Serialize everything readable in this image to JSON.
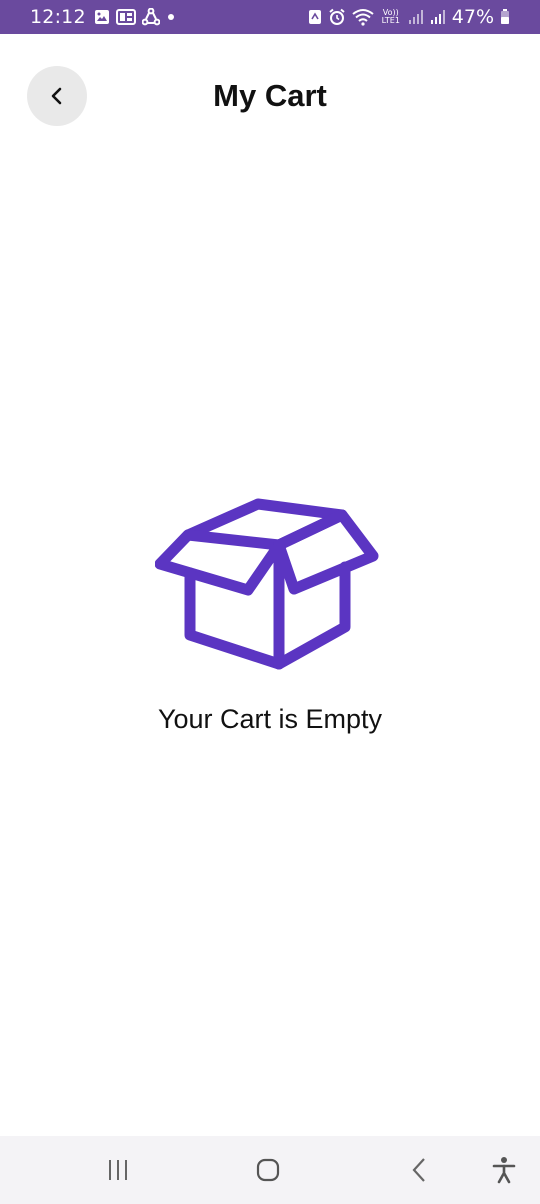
{
  "status_bar": {
    "time": "12:12",
    "battery_percent": "47%",
    "network_label": "Vo)) LTE1",
    "background_color": "#6a4a9e",
    "left_icons": [
      "gallery-icon",
      "sim-card-icon",
      "share-icon",
      "dot-icon"
    ],
    "right_icons": [
      "silent-icon",
      "alarm-icon",
      "wifi-icon",
      "signal-1-icon",
      "signal-2-icon",
      "battery-icon"
    ]
  },
  "header": {
    "title": "My Cart",
    "back_icon": "chevron-left-icon"
  },
  "empty_state": {
    "icon": "open-box-icon",
    "message": "Your Cart is Empty",
    "accent_color": "#5b35c2"
  },
  "nav_bar": {
    "buttons": [
      "recents-icon",
      "home-icon",
      "back-icon",
      "accessibility-icon"
    ]
  }
}
